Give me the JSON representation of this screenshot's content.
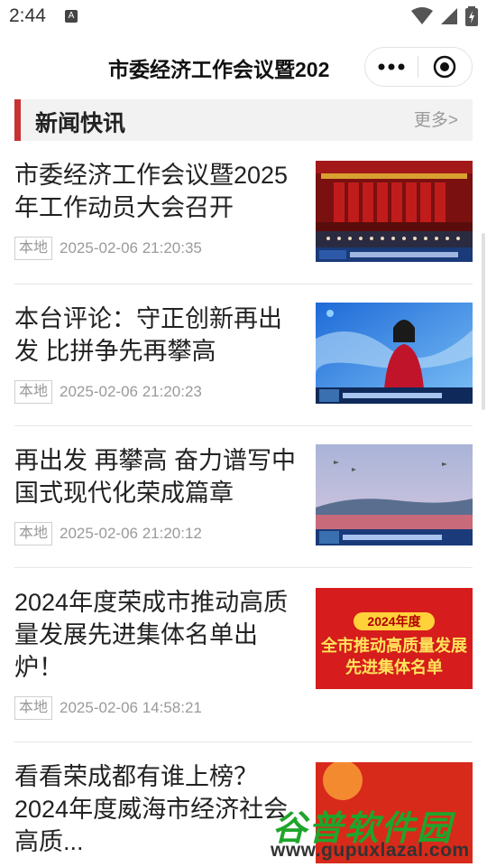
{
  "status_bar": {
    "time": "2:44",
    "notification_letter": "A"
  },
  "header": {
    "title": "市委经济工作会议暨202"
  },
  "section": {
    "title": "新闻快讯",
    "more_label": "更多>"
  },
  "news": [
    {
      "title": "市委经济工作会议暨2025年工作动员大会召开",
      "tag": "本地",
      "time": "2025-02-06 21:20:35",
      "thumb_caption": "市委经济工作会议暨2025年工作动员大会"
    },
    {
      "title": "本台评论：守正创新再出发 比拼争先再攀高",
      "tag": "本地",
      "time": "2025-02-06 21:20:23",
      "thumb_caption": "本台评论 守正创新再出发 比拼争先再攀高"
    },
    {
      "title": "再出发 再攀高 奋力谱写中国式现代化荣成篇章",
      "tag": "本地",
      "time": "2025-02-06 21:20:12",
      "thumb_caption": "再出发 再攀高 奋力谱写中国式现代化荣成篇章"
    },
    {
      "title": "2024年度荣成市推动高质量发展先进集体名单出炉！",
      "tag": "本地",
      "time": "2025-02-06 14:58:21",
      "thumb_year": "2024年度",
      "thumb_line1": "全市推动高质量发展",
      "thumb_line2": "先进集体名单"
    },
    {
      "title": "看看荣成都有谁上榜？2024年度威海市经济社会高质...",
      "tag": "",
      "time": ""
    }
  ],
  "watermark": {
    "text": "谷普软件园",
    "url": "www.gupuxlazal.com"
  },
  "colors": {
    "accent_red": "#c83232",
    "watermark_green": "#1fa52a"
  }
}
